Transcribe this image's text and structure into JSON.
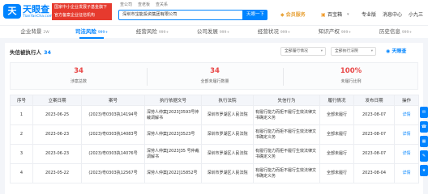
{
  "header": {
    "logo_mark": "天",
    "logo_text": "天眼查",
    "logo_url": "TianYanCha.com",
    "gov_badge_line1": "国家中小企业发展子基金旗下",
    "gov_badge_line2": "官方备案企业征信机构",
    "nav_links": [
      "查公司",
      "查老板",
      "查关系"
    ],
    "search_value": "深圳市宝能投资集团有限公司",
    "search_button": "天眼一下",
    "vip_label": "会员服务",
    "menu_items": [
      "百宝箱",
      "专业版",
      "消息中心",
      "小九三"
    ]
  },
  "tabs": [
    {
      "label": "企业背景",
      "count": "2W"
    },
    {
      "label": "司法风险",
      "count": "999+",
      "active": true
    },
    {
      "label": "经营风险",
      "count": "999+"
    },
    {
      "label": "公司发展",
      "count": "999+"
    },
    {
      "label": "经营状况",
      "count": "999+"
    },
    {
      "label": "知识产权",
      "count": "999+"
    },
    {
      "label": "历史信息",
      "count": "999+"
    }
  ],
  "section": {
    "title": "失信被执行人",
    "count": "34",
    "filter1": "全部履行情况",
    "filter2": "全部执行法院",
    "brand": "天眼查"
  },
  "stats": [
    {
      "value": "34",
      "label": "涉案总数"
    },
    {
      "value": "34",
      "label": "全部未履行数量"
    },
    {
      "value": "100%",
      "label": "未履行比例"
    }
  ],
  "table": {
    "headers": [
      "序号",
      "立案日期",
      "案号",
      "执行依据文号",
      "执行法院",
      "失信行为",
      "履行情况",
      "发布日期",
      "操作"
    ],
    "rows": [
      [
        "1",
        "2023-06-25",
        "(2023)粤0303执14194号",
        "深劳人仲案[2023]3593号仲裁调解书",
        "深圳市罗湖区人民法院",
        "有履行能力而拒不履行生效法律文书确定义务",
        "全部未履行",
        "2023-08-07",
        "详情"
      ],
      [
        "2",
        "2023-06-23",
        "(2023)粤0303执14083号",
        "深劳人仲案[2023]3523号",
        "深圳市罗湖区人民法院",
        "有履行能力而拒不履行生效法律文书确定义务",
        "全部未履行",
        "2023-08-07",
        "详情"
      ],
      [
        "3",
        "2023-06-23",
        "(2023)粤0303执14076号",
        "深劳人仲案[2023]35 号仲裁调解书",
        "深圳市罗湖区人民法院",
        "有履行能力而拒不履行生效法律文书确定义务",
        "全部未履行",
        "2023-08-07",
        "详情"
      ],
      [
        "4",
        "2023-05-22",
        "(2023)粤0303执12567号",
        "深劳人仲案[2022]15852号",
        "深圳市罗湖区人民法院",
        "有履行能力而拒不履行生效法律文书确定义务",
        "全部未履行",
        "2023-08-04",
        "详情"
      ]
    ]
  }
}
